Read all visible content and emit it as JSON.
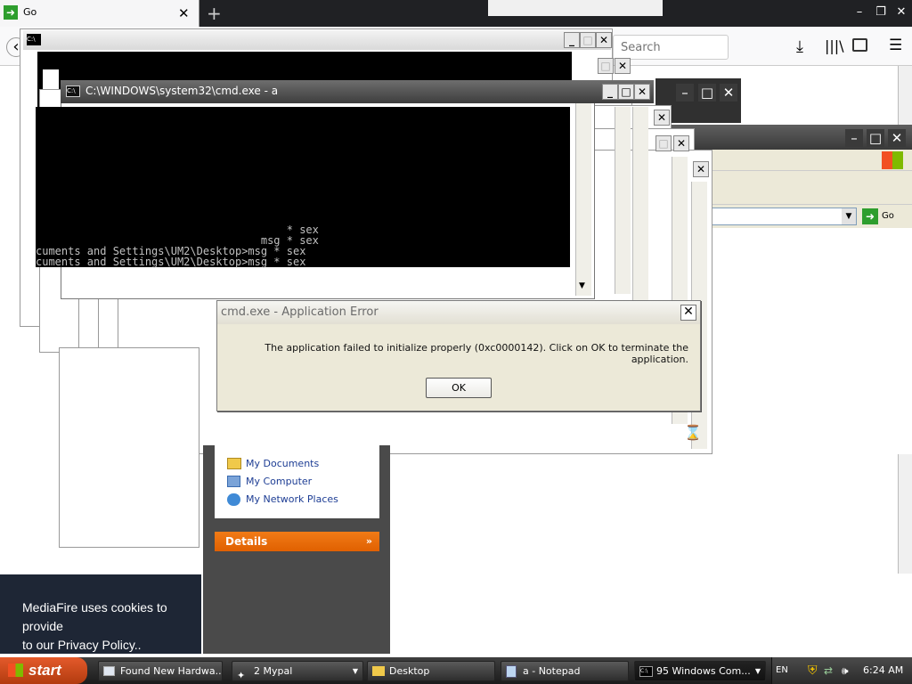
{
  "browser": {
    "tab_title": "Go",
    "new_tab_glyph": "+",
    "search_placeholder": "Search"
  },
  "cmd_window": {
    "title": "C:\\WINDOWS\\system32\\cmd.exe - a",
    "lines": [
      "                                       * sex",
      "                                   msg * sex",
      "cuments and Settings\\UM2\\Desktop>msg * sex",
      "cuments and Settings\\UM2\\Desktop>msg * sex"
    ]
  },
  "back_window": {
    "address_go": "Go"
  },
  "dialog": {
    "title": "cmd.exe - Application Error",
    "message": "The application failed to initialize properly (0xc0000142). Click on OK to terminate the application.",
    "ok_label": "OK"
  },
  "explorer": {
    "places": [
      "My Documents",
      "My Computer",
      "My Network Places"
    ],
    "details_label": "Details"
  },
  "mediafire_banner": {
    "line1": "MediaFire uses cookies to provide",
    "line2": "to our Privacy Policy.."
  },
  "taskbar": {
    "start_label": "start",
    "items": [
      "Found New Hardwa...",
      "2 Mypal",
      "Desktop",
      "a - Notepad",
      "95 Windows Com..."
    ],
    "clock": "6:24 AM",
    "lang": "EN"
  }
}
